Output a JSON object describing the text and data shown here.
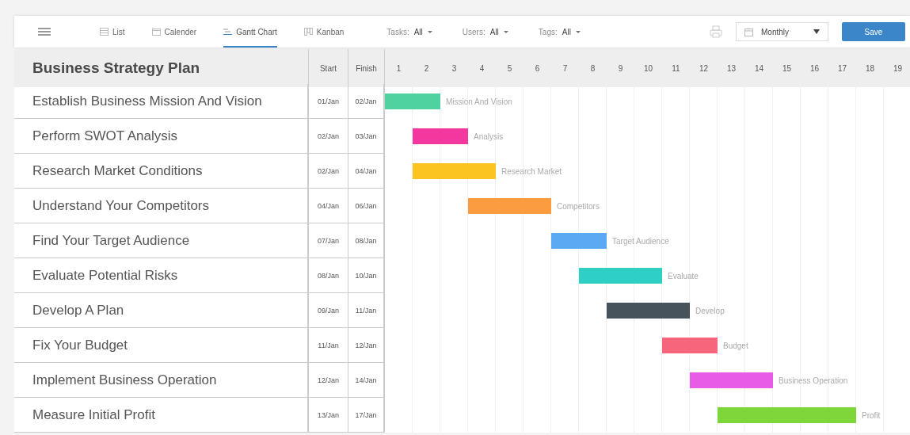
{
  "toolbar": {
    "views": [
      {
        "label": "List",
        "kind": "list",
        "selected": false
      },
      {
        "label": "Calender",
        "kind": "calendar",
        "selected": false
      },
      {
        "label": "Gantt Chart",
        "kind": "gantt",
        "selected": true
      },
      {
        "label": "Kanban",
        "kind": "kanban",
        "selected": false
      }
    ],
    "filters": [
      {
        "label": "Tasks:",
        "value": "All"
      },
      {
        "label": "Users:",
        "value": "All"
      },
      {
        "label": "Tags:",
        "value": "All"
      }
    ],
    "period": {
      "value": "Monthly"
    },
    "save_button": "Save"
  },
  "gantt": {
    "title": "Business Strategy Plan",
    "start_heading": "Start",
    "finish_heading": "Finish",
    "days": [
      "1",
      "2",
      "3",
      "4",
      "5",
      "6",
      "7",
      "8",
      "9",
      "10",
      "11",
      "12",
      "13",
      "14",
      "15",
      "16",
      "17",
      "18",
      "19"
    ],
    "tasks": [
      {
        "name": "Establish Business Mission And Vision",
        "start": "01/Jan",
        "finish": "02/Jan",
        "bar_label": "Mission And Vision",
        "color": "#4fd1a0"
      },
      {
        "name": "Perform SWOT Analysis",
        "start": "02/Jan",
        "finish": "03/Jan",
        "bar_label": "Analysis",
        "color": "#f2389f"
      },
      {
        "name": "Research Market Conditions",
        "start": "02/Jan",
        "finish": "04/Jan",
        "bar_label": "Research Market",
        "color": "#fbc421"
      },
      {
        "name": "Understand Your Competitors",
        "start": "04/Jan",
        "finish": "06/Jan",
        "bar_label": "Competitors",
        "color": "#fb9c40"
      },
      {
        "name": "Find Your Target Audience",
        "start": "07/Jan",
        "finish": "08/Jan",
        "bar_label": "Target Audience",
        "color": "#5aa9f2"
      },
      {
        "name": "Evaluate Potential Risks",
        "start": "08/Jan",
        "finish": "10/Jan",
        "bar_label": "Evaluate",
        "color": "#2ecfc4"
      },
      {
        "name": "Develop A Plan",
        "start": "09/Jan",
        "finish": "11/Jan",
        "bar_label": "Develop",
        "color": "#46535c"
      },
      {
        "name": "Fix Your Budget",
        "start": "11/Jan",
        "finish": "12/Jan",
        "bar_label": "Budget",
        "color": "#f6657a"
      },
      {
        "name": "Implement Business Operation",
        "start": "12/Jan",
        "finish": "14/Jan",
        "bar_label": "Business Operation",
        "color": "#e65ce6"
      },
      {
        "name": "Measure Initial Profit",
        "start": "13/Jan",
        "finish": "17/Jan",
        "bar_label": "Profit",
        "color": "#7ed63a"
      }
    ]
  }
}
